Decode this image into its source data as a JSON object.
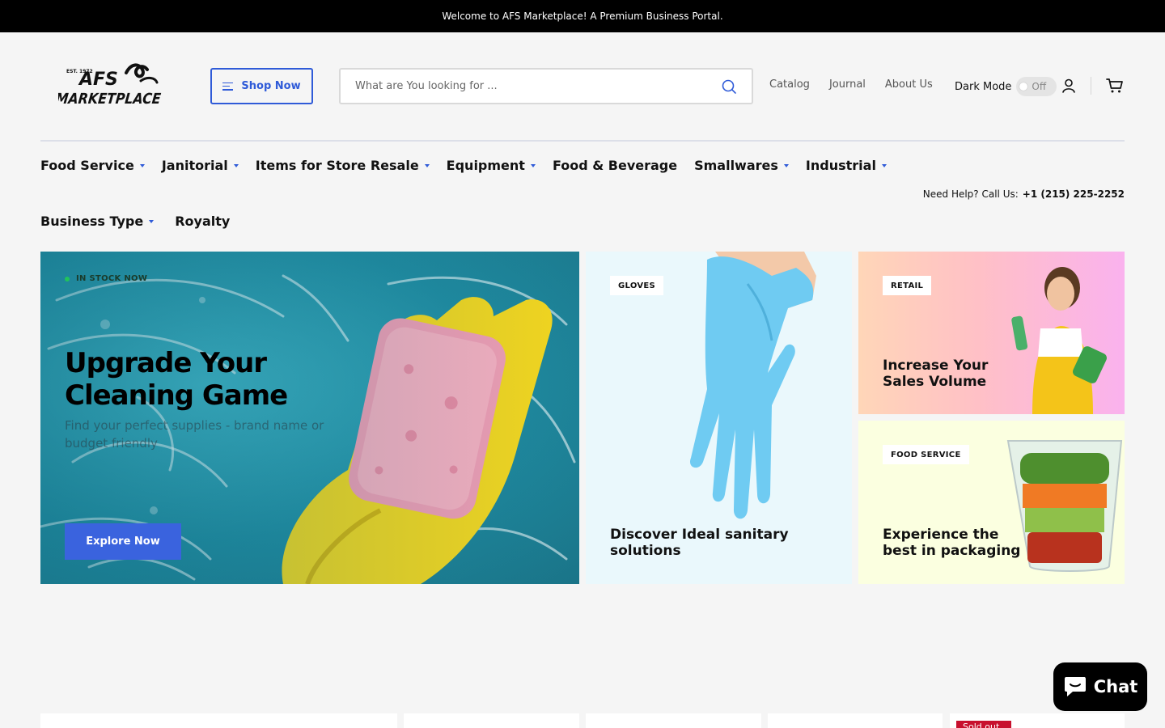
{
  "announcement": "Welcome to AFS Marketplace! A Premium Business Portal.",
  "header": {
    "logo_icon": "afs-marketplace-logo",
    "logo_small": "EST. 1972",
    "logo_line1": "AFS",
    "logo_line2": "MARKETPLACE",
    "shop_now_label": "Shop Now",
    "search_placeholder": "What are You looking for ...",
    "links": [
      "Catalog",
      "Journal",
      "About Us"
    ],
    "dark_mode_label": "Dark Mode",
    "dark_mode_state": "Off"
  },
  "nav": {
    "row1": [
      {
        "label": "Food Service",
        "dropdown": true
      },
      {
        "label": "Janitorial",
        "dropdown": true
      },
      {
        "label": "Items for Store Resale",
        "dropdown": true
      },
      {
        "label": "Equipment",
        "dropdown": true
      },
      {
        "label": "Food & Beverage",
        "dropdown": false
      },
      {
        "label": "Smallwares",
        "dropdown": true
      },
      {
        "label": "Industrial",
        "dropdown": true
      }
    ],
    "row2": [
      {
        "label": "Business Type",
        "dropdown": true
      },
      {
        "label": "Royalty",
        "dropdown": false
      }
    ]
  },
  "help": {
    "label": "Need Help? Call Us:",
    "phone": "+1 (215) 225-2252"
  },
  "hero": {
    "badge": "IN STOCK NOW",
    "title": "Upgrade Your Cleaning Game",
    "subtitle": "Find your perfect supplies - brand name or budget friendly",
    "cta": "Explore Now"
  },
  "cards": [
    {
      "tag": "GLOVES",
      "title": "Discover Ideal sanitary solutions"
    },
    {
      "tag": "RETAIL",
      "title": "Increase Your Sales Volume"
    },
    {
      "tag": "FOOD SERVICE",
      "title": "Experience the best in packaging"
    }
  ],
  "product_strip": {
    "sold_out_badge": "Sold out"
  },
  "chat": {
    "label": "Chat"
  },
  "colors": {
    "accent": "#2f5bd8",
    "announcement_bg": "#000000",
    "cta": "#3a63de",
    "sold_out": "#c8102e"
  }
}
